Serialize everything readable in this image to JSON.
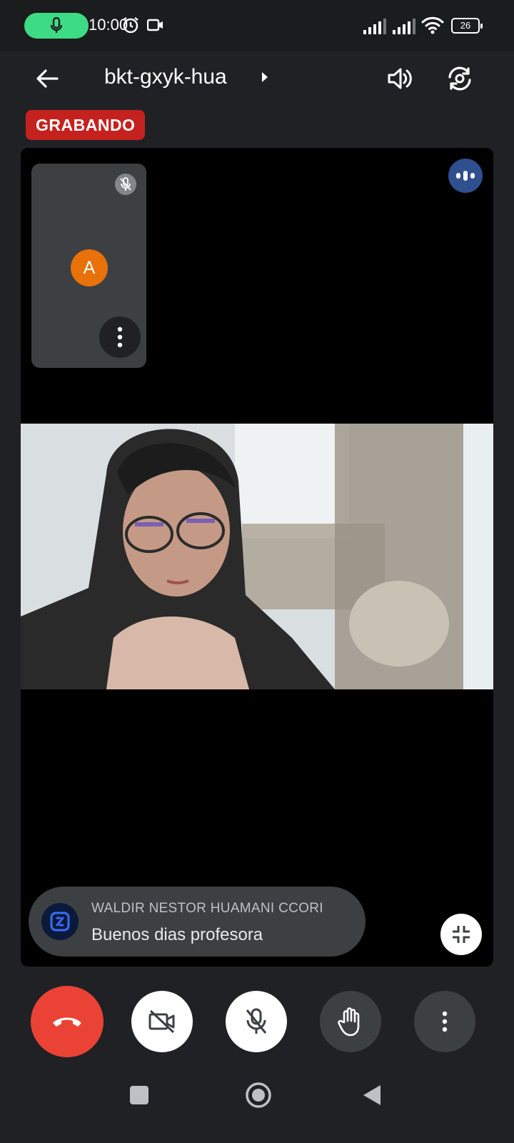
{
  "status_bar": {
    "time": "10:00",
    "battery": "26",
    "icons": [
      "mic-icon",
      "alarm-icon",
      "camera-icon",
      "signal-icon",
      "signal-icon",
      "wifi-icon",
      "battery-icon"
    ]
  },
  "header": {
    "meeting_code": "bkt-gxyk-hua",
    "icons": [
      "back-arrow-icon",
      "chevron-right-icon",
      "speaker-icon",
      "switch-camera-icon"
    ]
  },
  "recording_label": "GRABANDO",
  "self_tile": {
    "avatar_letter": "A",
    "icons": [
      "mic-off-icon",
      "more-vert-icon"
    ]
  },
  "caption": {
    "speaker_name": "WALDIR NESTOR HUAMANI CCORI",
    "text": "Buenos dias profesora"
  },
  "controls": {
    "icons": [
      "end-call-icon",
      "camera-off-icon",
      "mic-off-icon",
      "raise-hand-icon",
      "more-vert-icon"
    ]
  },
  "navbar": {
    "icons": [
      "recents-icon",
      "home-icon",
      "back-icon"
    ]
  },
  "colors": {
    "background": "#202124",
    "accent_green": "#3ddc84",
    "recording_red": "#c5221f",
    "end_call_red": "#ea4335",
    "avatar_orange": "#e8710a"
  }
}
